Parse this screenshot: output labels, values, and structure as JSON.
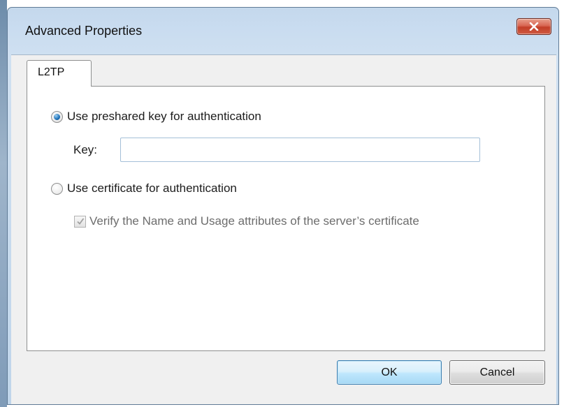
{
  "window": {
    "title": "Advanced Properties",
    "close_icon": "close-x-icon"
  },
  "tabs": [
    {
      "label": "L2TP",
      "selected": true
    }
  ],
  "auth": {
    "preshared_label": "Use preshared key for authentication",
    "preshared_selected": true,
    "key_label": "Key:",
    "key_value": "",
    "certificate_label": "Use certificate for authentication",
    "certificate_selected": false,
    "verify_label": "Verify the Name and Usage attributes of the server’s certificate",
    "verify_checked": true,
    "verify_enabled": false
  },
  "buttons": {
    "ok_label": "OK",
    "cancel_label": "Cancel"
  },
  "colors": {
    "close_button": "#c23e27",
    "ok_button_border": "#3c7fb1",
    "radio_selected": "#1a6fb7"
  }
}
